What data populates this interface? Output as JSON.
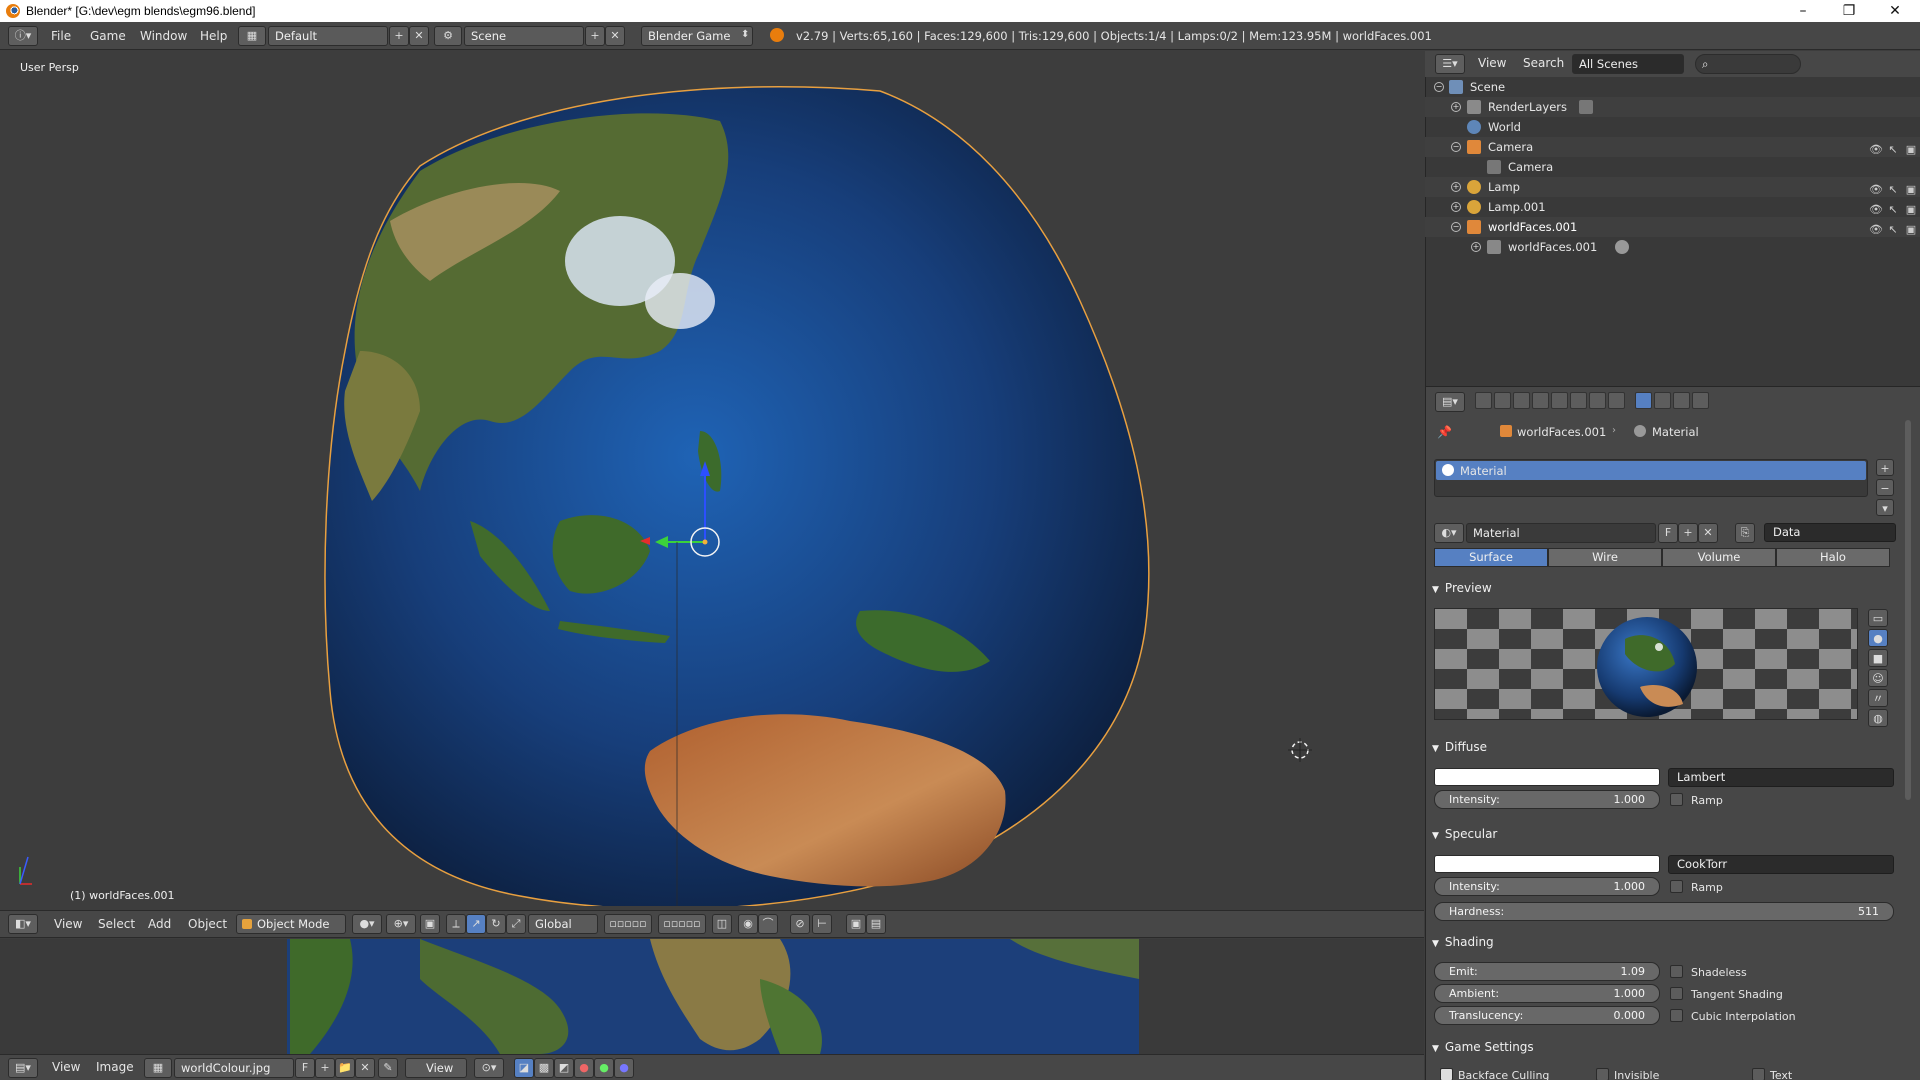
{
  "window": {
    "title": "Blender* [G:\\dev\\egm blends\\egm96.blend]",
    "minimize": "–",
    "maximize": "❐",
    "close": "✕"
  },
  "info_header": {
    "menus": [
      "File",
      "Game",
      "Window",
      "Help"
    ],
    "screen_layout": "Default",
    "scene": "Scene",
    "render_engine": "Blender Game",
    "stats": "v2.79 | Verts:65,160 | Faces:129,600 | Tris:129,600 | Objects:1/4 | Lamps:0/2 | Mem:123.95M | worldFaces.001"
  },
  "viewport": {
    "view_label": "User Persp",
    "object_label": "(1) worldFaces.001",
    "header": {
      "menus": [
        "View",
        "Select",
        "Add",
        "Object"
      ],
      "mode": "Object Mode",
      "orientation": "Global"
    }
  },
  "image_editor": {
    "menus": [
      "View",
      "Image"
    ],
    "image_name": "worldColour.jpg",
    "fake_user": "F",
    "view_menu": "View"
  },
  "outliner": {
    "menus": [
      "View",
      "Search"
    ],
    "display_mode": "All Scenes",
    "items": [
      {
        "label": "Scene"
      },
      {
        "label": "RenderLayers"
      },
      {
        "label": "World"
      },
      {
        "label": "Camera"
      },
      {
        "label": "Camera"
      },
      {
        "label": "Lamp"
      },
      {
        "label": "Lamp.001"
      },
      {
        "label": "worldFaces.001"
      },
      {
        "label": "worldFaces.001"
      }
    ]
  },
  "properties": {
    "breadcrumb": [
      "worldFaces.001",
      "Material"
    ],
    "material_slot": "Material",
    "material_name": "Material",
    "fake_user": "F",
    "link": "Data",
    "tabs": [
      "Surface",
      "Wire",
      "Volume",
      "Halo"
    ],
    "active_tab": "Surface",
    "panels": {
      "preview": "Preview",
      "diffuse": {
        "title": "Diffuse",
        "color": "#ffffff",
        "shader": "Lambert",
        "intensity_label": "Intensity:",
        "intensity": "1.000",
        "ramp": "Ramp"
      },
      "specular": {
        "title": "Specular",
        "color": "#ffffff",
        "shader": "CookTorr",
        "intensity_label": "Intensity:",
        "intensity": "1.000",
        "ramp": "Ramp",
        "hardness_label": "Hardness:",
        "hardness": "511"
      },
      "shading": {
        "title": "Shading",
        "emit_label": "Emit:",
        "emit": "1.09",
        "ambient_label": "Ambient:",
        "ambient": "1.000",
        "translucency_label": "Translucency:",
        "translucency": "0.000",
        "shadeless": "Shadeless",
        "tangent": "Tangent Shading",
        "cubic": "Cubic Interpolation"
      },
      "game_settings": {
        "title": "Game Settings",
        "backface": "Backface Culling",
        "invisible": "Invisible",
        "text": "Text"
      }
    }
  }
}
